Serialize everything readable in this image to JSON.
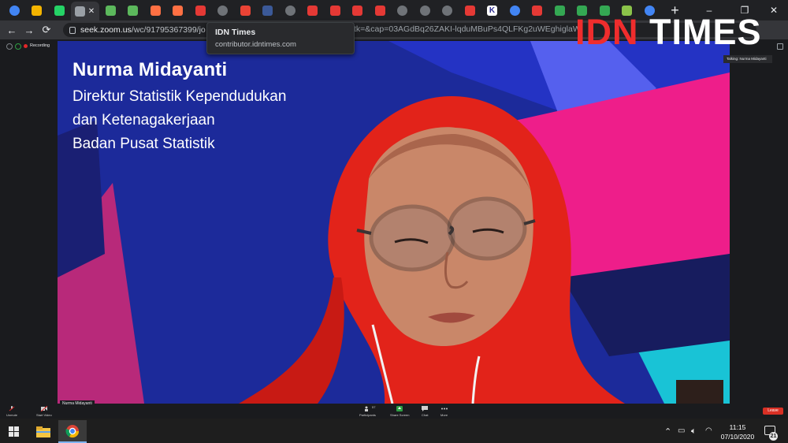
{
  "browser": {
    "tabs": [
      {
        "icon": "google-icon",
        "color": "#4285f4"
      },
      {
        "icon": "film-icon",
        "color": "#f4b400"
      },
      {
        "icon": "whatsapp-icon",
        "color": "#25d366"
      },
      {
        "icon": "zoom-tab-icon",
        "color": "#9aa0a6",
        "active": true,
        "close": "✕"
      },
      {
        "icon": "frog-icon",
        "color": "#5cb85c"
      },
      {
        "icon": "frog-icon",
        "color": "#5cb85c"
      },
      {
        "icon": "bag-icon",
        "color": "#ff7043"
      },
      {
        "icon": "bag-icon",
        "color": "#ff7043"
      },
      {
        "icon": "b-icon",
        "color": "#e53935"
      },
      {
        "icon": "loading-icon",
        "color": "#6f7378"
      },
      {
        "icon": "gmail-icon",
        "color": "#ea4335"
      },
      {
        "icon": "ci-icon",
        "color": "#3b5998"
      },
      {
        "icon": "loading-icon",
        "color": "#6f7378"
      },
      {
        "icon": "doc-icon",
        "color": "#e53935"
      },
      {
        "icon": "doc-icon",
        "color": "#e53935"
      },
      {
        "icon": "doc-icon",
        "color": "#e53935"
      },
      {
        "icon": "doc-icon",
        "color": "#e53935"
      },
      {
        "icon": "loading-icon",
        "color": "#6f7378"
      },
      {
        "icon": "loading-icon",
        "color": "#6f7378"
      },
      {
        "icon": "loading-icon",
        "color": "#6f7378"
      },
      {
        "icon": "doc-icon",
        "color": "#e53935"
      },
      {
        "icon": "k-icon",
        "color": "#2d2d8f",
        "letter": "K"
      },
      {
        "icon": "google-icon",
        "color": "#4285f4"
      },
      {
        "icon": "bookmark-icon",
        "color": "#e53935"
      },
      {
        "icon": "plus-green-icon",
        "color": "#34a853"
      },
      {
        "icon": "plus-green-icon",
        "color": "#34a853"
      },
      {
        "icon": "plus-green-icon",
        "color": "#34a853"
      },
      {
        "icon": "shield-green-icon",
        "color": "#8bc34a"
      },
      {
        "icon": "google-icon",
        "color": "#4285f4"
      }
    ],
    "new_tab": "+",
    "window_controls": {
      "minimize": "–",
      "restore": "❐",
      "close": "✕"
    },
    "url_host": "seek.zoom.us",
    "url_path": "/wc/91795367399/jo",
    "url_tail": "&tk=&cap=03AGdBq26ZAKI-lqduMBuPs4QLFKg2uWEghiglaW",
    "tooltip": {
      "title": "IDN Times",
      "subtitle": "contributor.idntimes.com"
    }
  },
  "watermark": {
    "part1": "IDN",
    "part2": "TIMES"
  },
  "zoom": {
    "recording": "Recording",
    "talking": "Talking: Nurma Midayanti",
    "nameplate": "Nurma Midayanti",
    "toolbar": [
      {
        "label": "Unmute",
        "icon": "mic-icon"
      },
      {
        "label": "Start Video",
        "icon": "video-icon"
      },
      {
        "label": "Participants",
        "icon": "participants-icon",
        "count": "57"
      },
      {
        "label": "Share Screen",
        "icon": "share-screen-icon"
      },
      {
        "label": "Chat",
        "icon": "chat-icon"
      },
      {
        "label": "More",
        "icon": "more-icon"
      }
    ],
    "leave": "Leave"
  },
  "speaker": {
    "name": "Nurma Midayanti",
    "title_line1": "Direktur Statistik Kependudukan",
    "title_line2": "dan Ketenagakerjaan",
    "org": "Badan Pusat Statistik"
  },
  "taskbar": {
    "time": "11:15",
    "date": "07/10/2020",
    "notifications": "21"
  },
  "colors": {
    "accent_red": "#ef2d2d",
    "zoom_blue": "#1c2a9a",
    "pink": "#ee1e8a",
    "hijab_red": "#e2231a"
  }
}
